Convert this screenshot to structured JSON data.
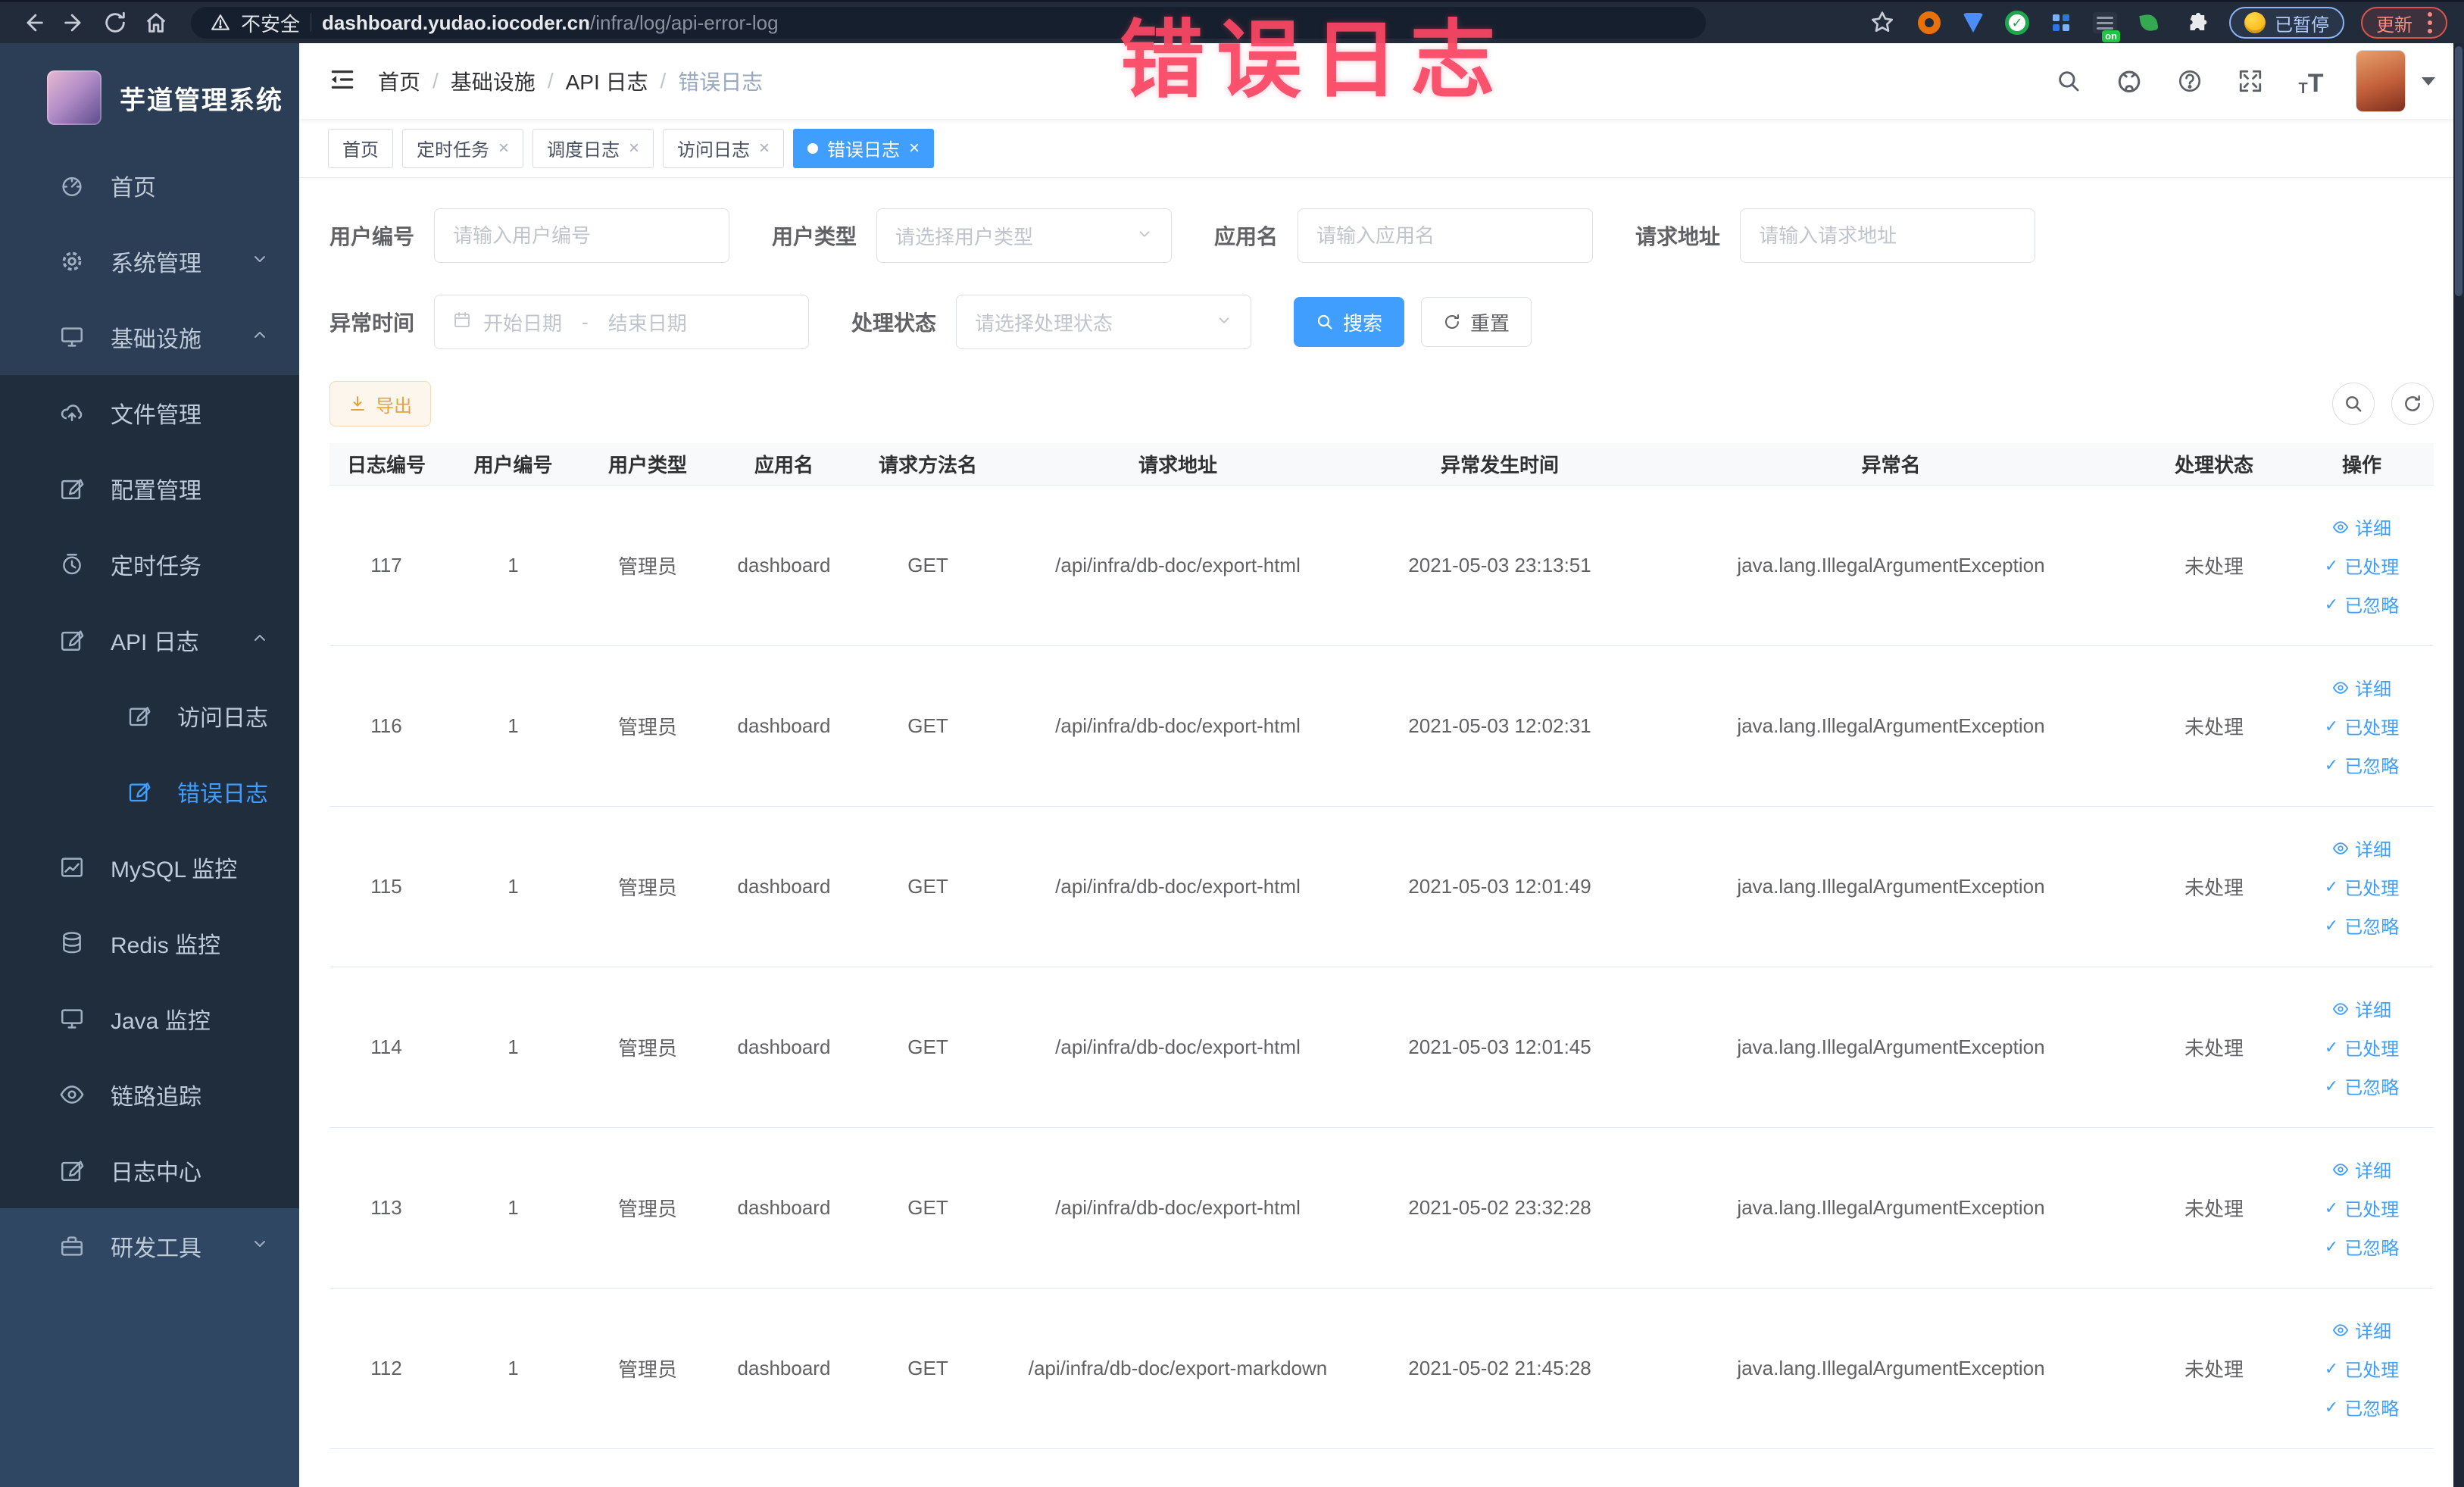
{
  "browser": {
    "security_label": "不安全",
    "url_domain": "dashboard.yudao.iocoder.cn",
    "url_path": "/infra/log/api-error-log",
    "paused_badge": "已暂停",
    "update_button": "更新"
  },
  "annotation": {
    "text": "错误日志",
    "color": "#fa4664"
  },
  "sidebar": {
    "app_title": "芋道管理系统",
    "items": [
      {
        "label": "首页"
      },
      {
        "label": "系统管理",
        "chevron": "down"
      },
      {
        "label": "基础设施",
        "chevron": "up"
      },
      {
        "label": "文件管理"
      },
      {
        "label": "配置管理"
      },
      {
        "label": "定时任务"
      },
      {
        "label": "API 日志",
        "chevron": "up"
      },
      {
        "label": "访问日志"
      },
      {
        "label": "错误日志",
        "active": true
      },
      {
        "label": "MySQL 监控"
      },
      {
        "label": "Redis 监控"
      },
      {
        "label": "Java 监控"
      },
      {
        "label": "链路追踪"
      },
      {
        "label": "日志中心"
      },
      {
        "label": "研发工具",
        "chevron": "down"
      }
    ]
  },
  "header": {
    "breadcrumb": [
      "首页",
      "基础设施",
      "API 日志",
      "错误日志"
    ],
    "separator": "/"
  },
  "tabs": [
    {
      "label": "首页",
      "closable": false,
      "active": false
    },
    {
      "label": "定时任务",
      "closable": true,
      "active": false
    },
    {
      "label": "调度日志",
      "closable": true,
      "active": false
    },
    {
      "label": "访问日志",
      "closable": true,
      "active": false
    },
    {
      "label": "错误日志",
      "closable": true,
      "active": true
    }
  ],
  "filters": {
    "user_id": {
      "label": "用户编号",
      "placeholder": "请输入用户编号"
    },
    "user_type": {
      "label": "用户类型",
      "placeholder": "请选择用户类型"
    },
    "app_name": {
      "label": "应用名",
      "placeholder": "请输入应用名"
    },
    "request_url": {
      "label": "请求地址",
      "placeholder": "请输入请求地址"
    },
    "exception_time": {
      "label": "异常时间",
      "start": "开始日期",
      "separator": "-",
      "end": "结束日期"
    },
    "process_status": {
      "label": "处理状态",
      "placeholder": "请选择处理状态"
    }
  },
  "buttons": {
    "search": "搜索",
    "reset": "重置",
    "export": "导出"
  },
  "table": {
    "columns": [
      "日志编号",
      "用户编号",
      "用户类型",
      "应用名",
      "请求方法名",
      "请求地址",
      "异常发生时间",
      "异常名",
      "处理状态",
      "操作"
    ],
    "row_actions": [
      "详细",
      "已处理",
      "已忽略"
    ],
    "rows": [
      {
        "id": "117",
        "user_id": "1",
        "user_type": "管理员",
        "app": "dashboard",
        "method": "GET",
        "url": "/api/infra/db-doc/export-html",
        "time": "2021-05-03 23:13:51",
        "exception": "java.lang.IllegalArgumentException",
        "status": "未处理"
      },
      {
        "id": "116",
        "user_id": "1",
        "user_type": "管理员",
        "app": "dashboard",
        "method": "GET",
        "url": "/api/infra/db-doc/export-html",
        "time": "2021-05-03 12:02:31",
        "exception": "java.lang.IllegalArgumentException",
        "status": "未处理"
      },
      {
        "id": "115",
        "user_id": "1",
        "user_type": "管理员",
        "app": "dashboard",
        "method": "GET",
        "url": "/api/infra/db-doc/export-html",
        "time": "2021-05-03 12:01:49",
        "exception": "java.lang.IllegalArgumentException",
        "status": "未处理"
      },
      {
        "id": "114",
        "user_id": "1",
        "user_type": "管理员",
        "app": "dashboard",
        "method": "GET",
        "url": "/api/infra/db-doc/export-html",
        "time": "2021-05-03 12:01:45",
        "exception": "java.lang.IllegalArgumentException",
        "status": "未处理"
      },
      {
        "id": "113",
        "user_id": "1",
        "user_type": "管理员",
        "app": "dashboard",
        "method": "GET",
        "url": "/api/infra/db-doc/export-html",
        "time": "2021-05-02 23:32:28",
        "exception": "java.lang.IllegalArgumentException",
        "status": "未处理"
      },
      {
        "id": "112",
        "user_id": "1",
        "user_type": "管理员",
        "app": "dashboard",
        "method": "GET",
        "url": "/api/infra/db-doc/export-markdown",
        "time": "2021-05-02 21:45:28",
        "exception": "java.lang.IllegalArgumentException",
        "status": "未处理"
      }
    ]
  },
  "colors": {
    "accent": "#409eff",
    "warning": "#e6a23c",
    "sidebar_bg": "#2c3e55",
    "submenu_bg": "#1f2d3d"
  }
}
